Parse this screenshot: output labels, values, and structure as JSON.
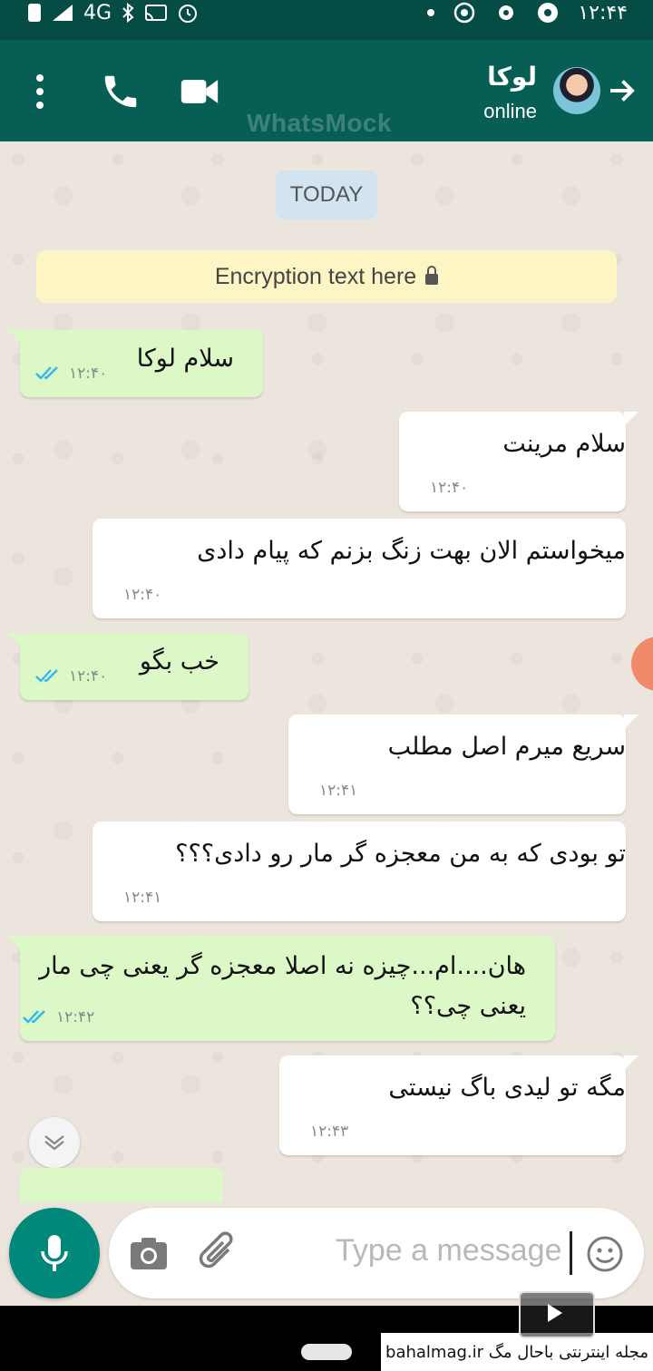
{
  "status_bar": {
    "network": "4G",
    "time": "۱۲:۴۴"
  },
  "header": {
    "contact_name": "لوکا",
    "contact_status": "online",
    "watermark": "WhatsMock"
  },
  "chat": {
    "date_chip": "TODAY",
    "encryption_text": "Encryption text here",
    "messages": [
      {
        "direction": "out",
        "text": "سلام لوکا",
        "time": "۱۲:۴۰",
        "read": true
      },
      {
        "direction": "in",
        "text": "سلام مرینت",
        "time": "۱۲:۴۰"
      },
      {
        "direction": "in",
        "text": "میخواستم الان بهت زنگ بزنم که پیام دادی",
        "time": "۱۲:۴۰"
      },
      {
        "direction": "out",
        "text": "خب بگو",
        "time": "۱۲:۴۰",
        "read": true
      },
      {
        "direction": "in",
        "text": "سریع میرم اصل مطلب",
        "time": "۱۲:۴۱"
      },
      {
        "direction": "in",
        "text": "تو بودی که به من معجزه گر مار رو دادی؟؟؟",
        "time": "۱۲:۴۱"
      },
      {
        "direction": "out",
        "text_line1": "هان....ام...چیزه نه اصلا معجزه گر یعنی چی مار",
        "text_line2": "یعنی چی؟؟",
        "time": "۱۲:۴۲",
        "read": true
      },
      {
        "direction": "in",
        "text": "مگه تو لیدی باگ نیستی",
        "time": "۱۲:۴۳"
      }
    ]
  },
  "input": {
    "placeholder": "Type a message"
  },
  "footer": {
    "credit": "مجله اینترنتی باحال مگ bahalmag.ir"
  },
  "colors": {
    "header": "#075e54",
    "status_bar": "#054d44",
    "outgoing": "#dcf8c6",
    "incoming": "#ffffff",
    "mic": "#00897b"
  },
  "icons": [
    "menu-icon",
    "phone-icon",
    "video-icon",
    "back-arrow-icon",
    "double-check-icon",
    "chevron-down-icon",
    "mic-icon",
    "camera-icon",
    "paperclip-icon",
    "emoji-icon"
  ]
}
